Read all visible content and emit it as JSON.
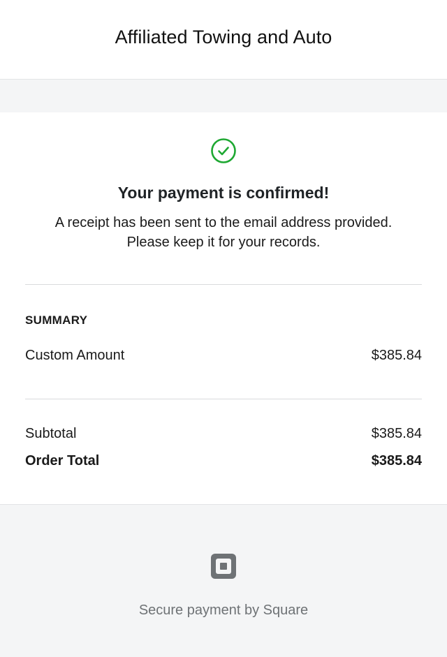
{
  "header": {
    "merchant_name": "Affiliated Towing and Auto"
  },
  "confirmation": {
    "icon": "check-circle-icon",
    "title": "Your payment is confirmed!",
    "message_line1": "A receipt has been sent to the email address provided.",
    "message_line2": "Please keep it for your records."
  },
  "summary": {
    "label": "SUMMARY",
    "items": [
      {
        "name": "Custom Amount",
        "price": "$385.84"
      }
    ],
    "subtotal_label": "Subtotal",
    "subtotal_value": "$385.84",
    "total_label": "Order Total",
    "total_value": "$385.84"
  },
  "footer": {
    "logo_icon": "square-logo-icon",
    "secure_text": "Secure payment by Square"
  },
  "colors": {
    "success_green": "#1ea832",
    "logo_gray": "#6e7275",
    "page_background": "#f4f5f6"
  }
}
